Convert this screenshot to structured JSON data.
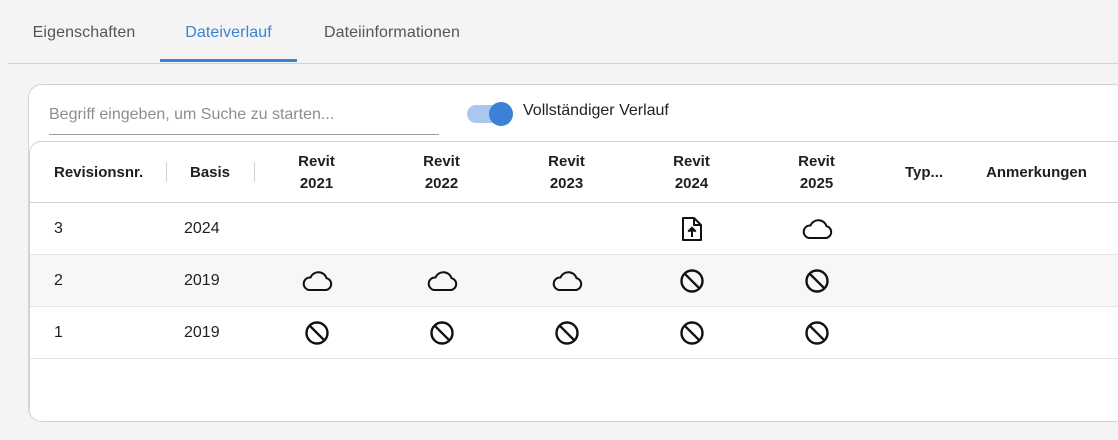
{
  "tabs": [
    {
      "label": "Eigenschaften"
    },
    {
      "label": "Dateiverlauf",
      "active": true
    },
    {
      "label": "Dateiinformationen"
    }
  ],
  "search": {
    "placeholder": "Begriff eingeben, um Suche zu starten..."
  },
  "toggle": {
    "label": "Vollständiger Verlauf",
    "on": true
  },
  "table": {
    "headers": {
      "revision": "Revisionsnr.",
      "basis": "Basis",
      "revit": [
        {
          "line1": "Revit",
          "line2": "2021"
        },
        {
          "line1": "Revit",
          "line2": "2022"
        },
        {
          "line1": "Revit",
          "line2": "2023"
        },
        {
          "line1": "Revit",
          "line2": "2024"
        },
        {
          "line1": "Revit",
          "line2": "2025"
        }
      ],
      "typ": "Typ...",
      "anmerkungen": "Anmerkungen"
    },
    "rows": [
      {
        "revision": "3",
        "basis": "2024",
        "icons": [
          "",
          "",
          "",
          "file-upload-icon",
          "cloud-icon"
        ]
      },
      {
        "revision": "2",
        "basis": "2019",
        "icons": [
          "cloud-icon",
          "cloud-icon",
          "cloud-icon",
          "prohibited-icon",
          "prohibited-icon"
        ]
      },
      {
        "revision": "1",
        "basis": "2019",
        "icons": [
          "prohibited-icon",
          "prohibited-icon",
          "prohibited-icon",
          "prohibited-icon",
          "prohibited-icon"
        ]
      }
    ]
  },
  "colors": {
    "accent": "#3b82d6",
    "toggle_track": "#a9c8f0"
  }
}
